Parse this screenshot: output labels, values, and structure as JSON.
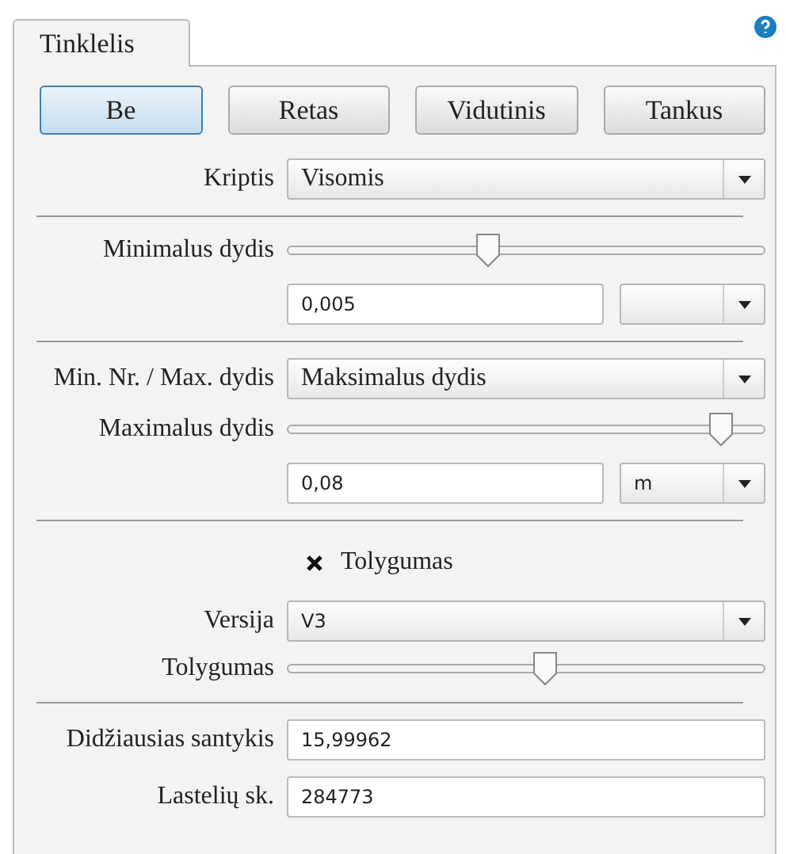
{
  "tab": {
    "label": "Tinklelis",
    "selected": true
  },
  "density_buttons": [
    {
      "label": "Be",
      "selected": true
    },
    {
      "label": "Retas",
      "selected": false
    },
    {
      "label": "Vidutinis",
      "selected": false
    },
    {
      "label": "Tankus",
      "selected": false
    }
  ],
  "direction": {
    "label": "Kriptis",
    "value": "Visomis"
  },
  "min_size": {
    "label": "Minimalus dydis",
    "level": 0.42,
    "value": "0,005"
  },
  "mode": {
    "label": "Min. Nr. / Max. dydis",
    "value": "Maksimalus dydis"
  },
  "max_size": {
    "label": "Maximalus dydis",
    "level": 0.91,
    "value": "0,08",
    "unit": "m"
  },
  "smoothing": {
    "label": "Tolygumas",
    "checked": true
  },
  "version": {
    "label": "Versija",
    "value": "V3"
  },
  "smoothness": {
    "label": "Tolygumas",
    "level": 0.54
  },
  "max_ratio": {
    "label": "Didžiausias santykis",
    "value": "15,99962"
  },
  "cell_count": {
    "label": "Lastelių sk.",
    "value": "284773"
  }
}
